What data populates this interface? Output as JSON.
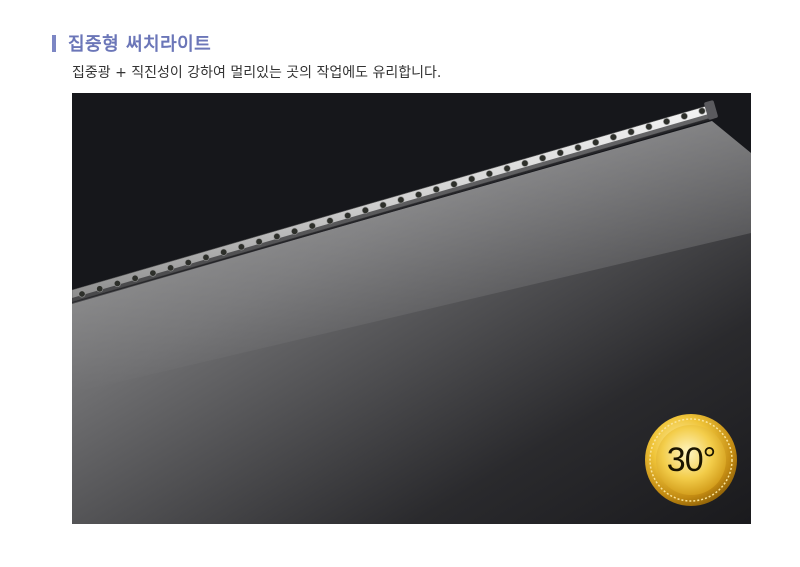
{
  "section": {
    "title": "집중형 써치라이트",
    "subtitle": "집중광 + 직진성이 강하여 멀리있는 곳의 작업에도 유리합니다."
  },
  "badge": {
    "angle_text": "30°"
  },
  "colors": {
    "accent": "#6b76b8",
    "accent_bar": "#7c86c4",
    "subtitle_text": "#333333",
    "image_bg": "#16171b",
    "badge_gold": "#d9a921"
  },
  "icons": {
    "badge": "gold-medal-icon",
    "title_marker": "vertical-bar-icon"
  }
}
